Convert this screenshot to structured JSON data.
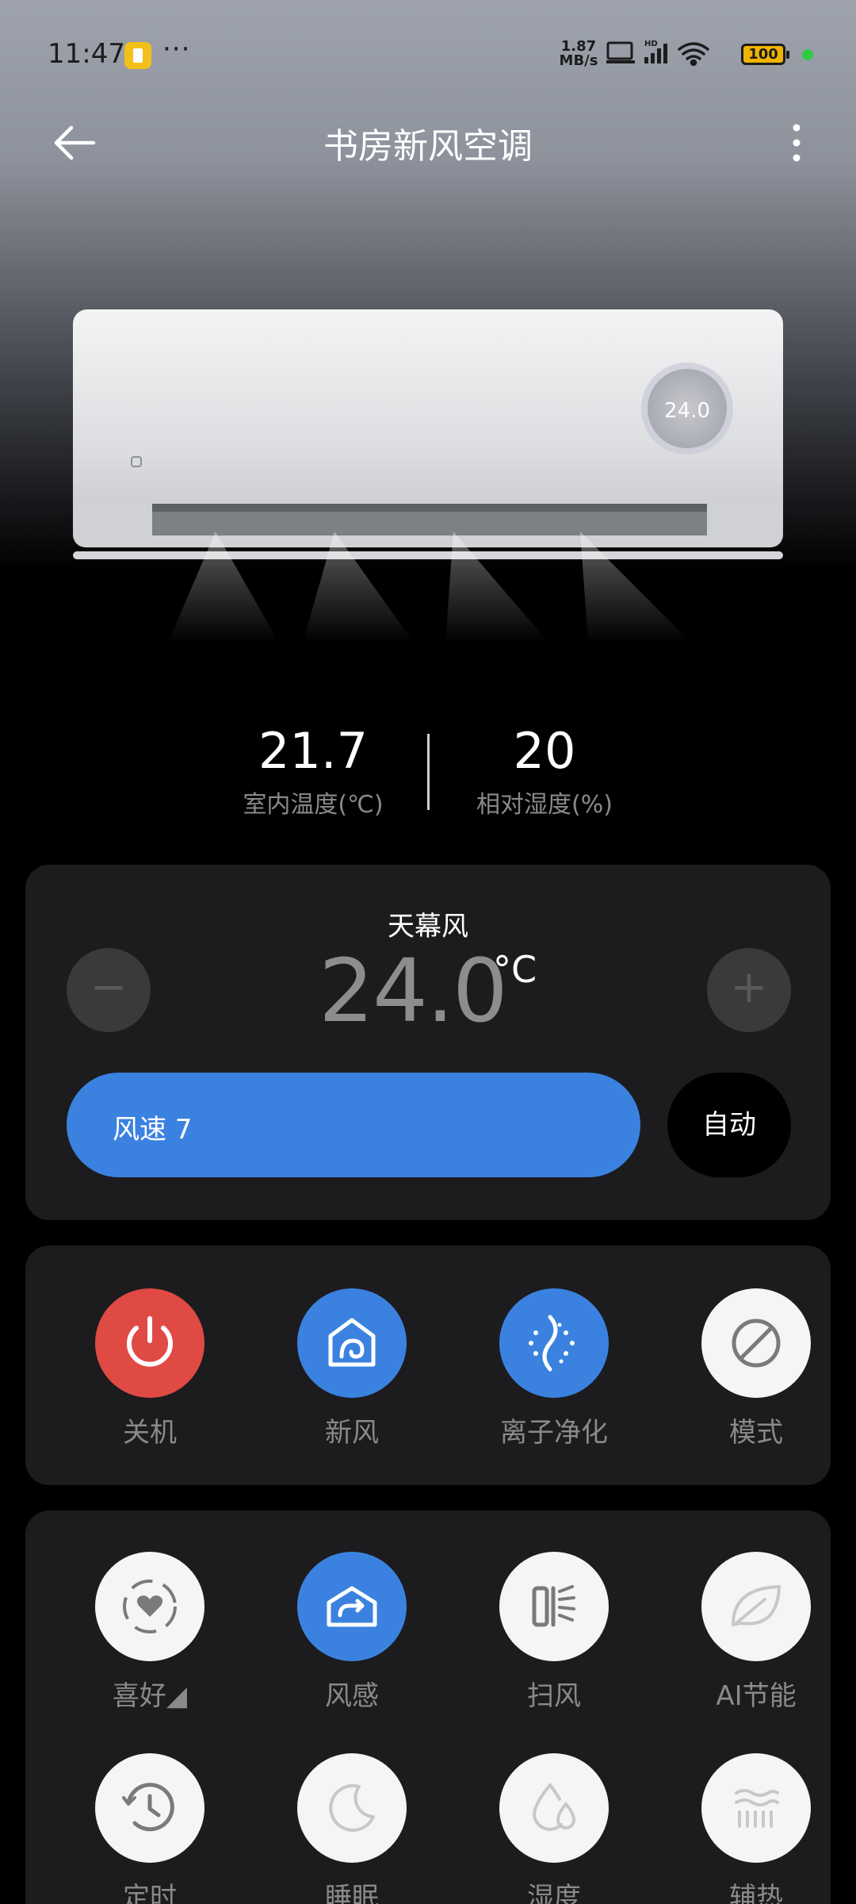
{
  "status_bar": {
    "time": "11:47",
    "dots": "···",
    "net_speed_value": "1.87",
    "net_speed_unit": "MB/s",
    "battery": "100"
  },
  "header": {
    "title": "书房新风空调"
  },
  "device": {
    "display_temp": "24.0"
  },
  "sensors": {
    "indoor_temp": {
      "value": "21.7",
      "label": "室内温度(℃)"
    },
    "humidity": {
      "value": "20",
      "label": "相对湿度(%)"
    }
  },
  "control": {
    "mode_label": "天幕风",
    "target_temp": "24.0",
    "temp_unit": "°C",
    "minus": "−",
    "plus": "+",
    "fan_speed_label": "风速 7",
    "auto_label": "自动"
  },
  "quick_actions": [
    {
      "label": "关机",
      "icon": "power-icon"
    },
    {
      "label": "新风",
      "icon": "fresh-air-icon"
    },
    {
      "label": "离子净化",
      "icon": "ion-purify-icon"
    },
    {
      "label": "模式",
      "icon": "mode-icon"
    }
  ],
  "features": [
    {
      "label": "喜好◢",
      "icon": "favorite-icon"
    },
    {
      "label": "风感",
      "icon": "wind-feel-icon"
    },
    {
      "label": "扫风",
      "icon": "swing-icon"
    },
    {
      "label": "AI节能",
      "icon": "leaf-icon"
    },
    {
      "label": "定时",
      "icon": "timer-icon"
    },
    {
      "label": "睡眠",
      "icon": "moon-icon"
    },
    {
      "label": "湿度",
      "icon": "humidity-icon"
    },
    {
      "label": "辅热",
      "icon": "aux-heat-icon"
    }
  ],
  "colors": {
    "accent_blue": "#3b82e0",
    "power_red": "#e04a44",
    "card_bg": "#1c1c1e"
  }
}
